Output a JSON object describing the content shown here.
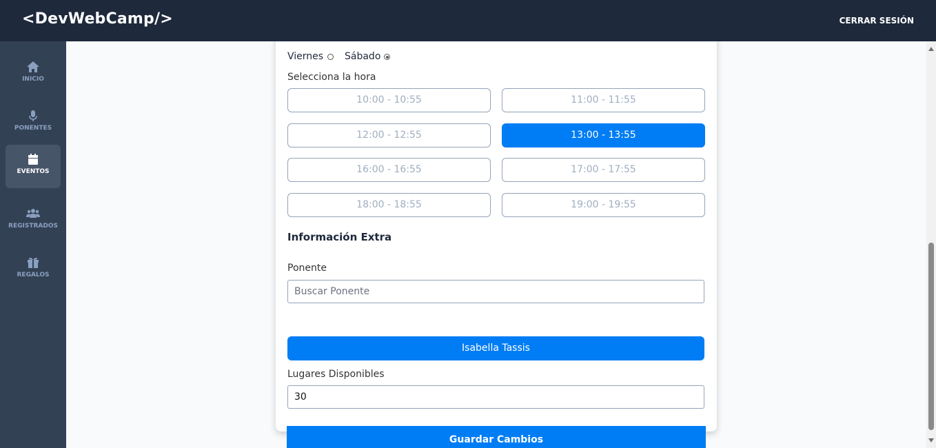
{
  "header": {
    "logo": "<DevWebCamp/>",
    "logout_label": "CERRAR SESIÓN"
  },
  "sidebar": {
    "items": [
      {
        "label": "INICIO",
        "icon": "home-icon",
        "active": false
      },
      {
        "label": "PONENTES",
        "icon": "microphone-icon",
        "active": false
      },
      {
        "label": "EVENTOS",
        "icon": "calendar-icon",
        "active": true
      },
      {
        "label": "REGISTRADOS",
        "icon": "users-icon",
        "active": false
      },
      {
        "label": "REGALOS",
        "icon": "gift-icon",
        "active": false
      }
    ]
  },
  "form": {
    "day_options": [
      {
        "label": "Viernes",
        "checked": false
      },
      {
        "label": "Sábado",
        "checked": true
      }
    ],
    "hour_label": "Selecciona la hora",
    "hours": [
      {
        "label": "10:00 - 10:55",
        "selected": false
      },
      {
        "label": "11:00 - 11:55",
        "selected": false
      },
      {
        "label": "12:00 - 12:55",
        "selected": false
      },
      {
        "label": "13:00 - 13:55",
        "selected": true
      },
      {
        "label": "16:00 - 16:55",
        "selected": false
      },
      {
        "label": "17:00 - 17:55",
        "selected": false
      },
      {
        "label": "18:00 - 18:55",
        "selected": false
      },
      {
        "label": "19:00 - 19:55",
        "selected": false
      }
    ],
    "extra_title": "Información Extra",
    "speaker_label": "Ponente",
    "speaker_search_placeholder": "Buscar Ponente",
    "selected_speaker": "Isabella Tassis",
    "places_label": "Lugares Disponibles",
    "places_value": "30",
    "save_label": "Guardar Cambios"
  },
  "colors": {
    "header": "#1e293b",
    "sidebar": "#334155",
    "accent": "#007df4"
  }
}
